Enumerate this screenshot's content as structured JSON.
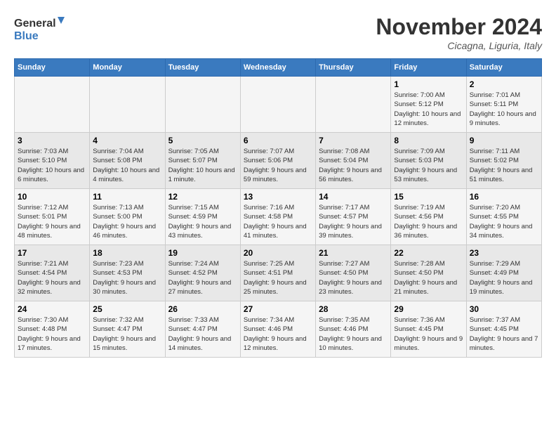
{
  "logo": {
    "line1": "General",
    "line2": "Blue"
  },
  "title": "November 2024",
  "subtitle": "Cicagna, Liguria, Italy",
  "headers": [
    "Sunday",
    "Monday",
    "Tuesday",
    "Wednesday",
    "Thursday",
    "Friday",
    "Saturday"
  ],
  "weeks": [
    [
      {
        "day": "",
        "sunrise": "",
        "sunset": "",
        "daylight": ""
      },
      {
        "day": "",
        "sunrise": "",
        "sunset": "",
        "daylight": ""
      },
      {
        "day": "",
        "sunrise": "",
        "sunset": "",
        "daylight": ""
      },
      {
        "day": "",
        "sunrise": "",
        "sunset": "",
        "daylight": ""
      },
      {
        "day": "",
        "sunrise": "",
        "sunset": "",
        "daylight": ""
      },
      {
        "day": "1",
        "sunrise": "Sunrise: 7:00 AM",
        "sunset": "Sunset: 5:12 PM",
        "daylight": "Daylight: 10 hours and 12 minutes."
      },
      {
        "day": "2",
        "sunrise": "Sunrise: 7:01 AM",
        "sunset": "Sunset: 5:11 PM",
        "daylight": "Daylight: 10 hours and 9 minutes."
      }
    ],
    [
      {
        "day": "3",
        "sunrise": "Sunrise: 7:03 AM",
        "sunset": "Sunset: 5:10 PM",
        "daylight": "Daylight: 10 hours and 6 minutes."
      },
      {
        "day": "4",
        "sunrise": "Sunrise: 7:04 AM",
        "sunset": "Sunset: 5:08 PM",
        "daylight": "Daylight: 10 hours and 4 minutes."
      },
      {
        "day": "5",
        "sunrise": "Sunrise: 7:05 AM",
        "sunset": "Sunset: 5:07 PM",
        "daylight": "Daylight: 10 hours and 1 minute."
      },
      {
        "day": "6",
        "sunrise": "Sunrise: 7:07 AM",
        "sunset": "Sunset: 5:06 PM",
        "daylight": "Daylight: 9 hours and 59 minutes."
      },
      {
        "day": "7",
        "sunrise": "Sunrise: 7:08 AM",
        "sunset": "Sunset: 5:04 PM",
        "daylight": "Daylight: 9 hours and 56 minutes."
      },
      {
        "day": "8",
        "sunrise": "Sunrise: 7:09 AM",
        "sunset": "Sunset: 5:03 PM",
        "daylight": "Daylight: 9 hours and 53 minutes."
      },
      {
        "day": "9",
        "sunrise": "Sunrise: 7:11 AM",
        "sunset": "Sunset: 5:02 PM",
        "daylight": "Daylight: 9 hours and 51 minutes."
      }
    ],
    [
      {
        "day": "10",
        "sunrise": "Sunrise: 7:12 AM",
        "sunset": "Sunset: 5:01 PM",
        "daylight": "Daylight: 9 hours and 48 minutes."
      },
      {
        "day": "11",
        "sunrise": "Sunrise: 7:13 AM",
        "sunset": "Sunset: 5:00 PM",
        "daylight": "Daylight: 9 hours and 46 minutes."
      },
      {
        "day": "12",
        "sunrise": "Sunrise: 7:15 AM",
        "sunset": "Sunset: 4:59 PM",
        "daylight": "Daylight: 9 hours and 43 minutes."
      },
      {
        "day": "13",
        "sunrise": "Sunrise: 7:16 AM",
        "sunset": "Sunset: 4:58 PM",
        "daylight": "Daylight: 9 hours and 41 minutes."
      },
      {
        "day": "14",
        "sunrise": "Sunrise: 7:17 AM",
        "sunset": "Sunset: 4:57 PM",
        "daylight": "Daylight: 9 hours and 39 minutes."
      },
      {
        "day": "15",
        "sunrise": "Sunrise: 7:19 AM",
        "sunset": "Sunset: 4:56 PM",
        "daylight": "Daylight: 9 hours and 36 minutes."
      },
      {
        "day": "16",
        "sunrise": "Sunrise: 7:20 AM",
        "sunset": "Sunset: 4:55 PM",
        "daylight": "Daylight: 9 hours and 34 minutes."
      }
    ],
    [
      {
        "day": "17",
        "sunrise": "Sunrise: 7:21 AM",
        "sunset": "Sunset: 4:54 PM",
        "daylight": "Daylight: 9 hours and 32 minutes."
      },
      {
        "day": "18",
        "sunrise": "Sunrise: 7:23 AM",
        "sunset": "Sunset: 4:53 PM",
        "daylight": "Daylight: 9 hours and 30 minutes."
      },
      {
        "day": "19",
        "sunrise": "Sunrise: 7:24 AM",
        "sunset": "Sunset: 4:52 PM",
        "daylight": "Daylight: 9 hours and 27 minutes."
      },
      {
        "day": "20",
        "sunrise": "Sunrise: 7:25 AM",
        "sunset": "Sunset: 4:51 PM",
        "daylight": "Daylight: 9 hours and 25 minutes."
      },
      {
        "day": "21",
        "sunrise": "Sunrise: 7:27 AM",
        "sunset": "Sunset: 4:50 PM",
        "daylight": "Daylight: 9 hours and 23 minutes."
      },
      {
        "day": "22",
        "sunrise": "Sunrise: 7:28 AM",
        "sunset": "Sunset: 4:50 PM",
        "daylight": "Daylight: 9 hours and 21 minutes."
      },
      {
        "day": "23",
        "sunrise": "Sunrise: 7:29 AM",
        "sunset": "Sunset: 4:49 PM",
        "daylight": "Daylight: 9 hours and 19 minutes."
      }
    ],
    [
      {
        "day": "24",
        "sunrise": "Sunrise: 7:30 AM",
        "sunset": "Sunset: 4:48 PM",
        "daylight": "Daylight: 9 hours and 17 minutes."
      },
      {
        "day": "25",
        "sunrise": "Sunrise: 7:32 AM",
        "sunset": "Sunset: 4:47 PM",
        "daylight": "Daylight: 9 hours and 15 minutes."
      },
      {
        "day": "26",
        "sunrise": "Sunrise: 7:33 AM",
        "sunset": "Sunset: 4:47 PM",
        "daylight": "Daylight: 9 hours and 14 minutes."
      },
      {
        "day": "27",
        "sunrise": "Sunrise: 7:34 AM",
        "sunset": "Sunset: 4:46 PM",
        "daylight": "Daylight: 9 hours and 12 minutes."
      },
      {
        "day": "28",
        "sunrise": "Sunrise: 7:35 AM",
        "sunset": "Sunset: 4:46 PM",
        "daylight": "Daylight: 9 hours and 10 minutes."
      },
      {
        "day": "29",
        "sunrise": "Sunrise: 7:36 AM",
        "sunset": "Sunset: 4:45 PM",
        "daylight": "Daylight: 9 hours and 9 minutes."
      },
      {
        "day": "30",
        "sunrise": "Sunrise: 7:37 AM",
        "sunset": "Sunset: 4:45 PM",
        "daylight": "Daylight: 9 hours and 7 minutes."
      }
    ]
  ]
}
